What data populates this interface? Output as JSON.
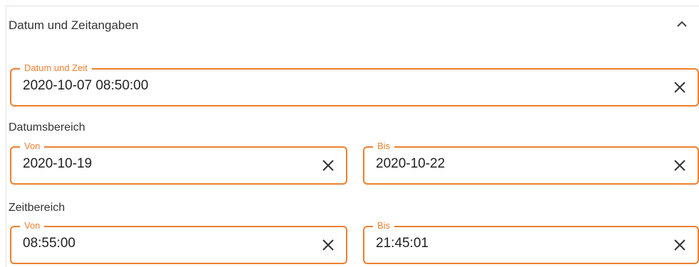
{
  "panel": {
    "title": "Datum und Zeitangaben"
  },
  "datetime": {
    "label": "Datum und Zeit",
    "value": "2020-10-07 08:50:00"
  },
  "date_range": {
    "section_label": "Datumsbereich",
    "from": {
      "label": "Von",
      "value": "2020-10-19"
    },
    "to": {
      "label": "Bis",
      "value": "2020-10-22"
    }
  },
  "time_range": {
    "section_label": "Zeitbereich",
    "from": {
      "label": "Von",
      "value": "08:55:00"
    },
    "to": {
      "label": "Bis",
      "value": "21:45:01"
    }
  },
  "colors": {
    "accent": "#ee7f2d",
    "text": "#1f1f1f"
  },
  "icons": {
    "collapse": "chevron-up-icon",
    "clear": "close-icon"
  }
}
